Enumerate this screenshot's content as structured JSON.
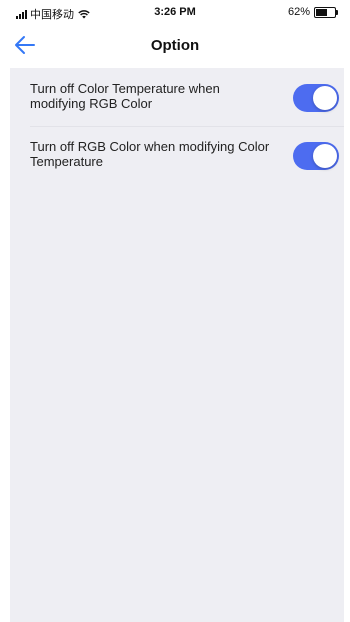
{
  "status_bar": {
    "carrier": "中国移动",
    "time": "3:26 PM",
    "battery": "62%",
    "battery_level": 0.62
  },
  "nav": {
    "title": "Option",
    "back_icon": "arrow-left-icon",
    "accent": "#3478f6"
  },
  "options": [
    {
      "label": "Turn off Color Temperature when modifying RGB Color",
      "enabled": true
    },
    {
      "label": "Turn off RGB Color when modifying Color Temperature",
      "enabled": true
    }
  ],
  "colors": {
    "toggle_on": "#4d6cf0",
    "content_bg": "#eeeef3"
  }
}
